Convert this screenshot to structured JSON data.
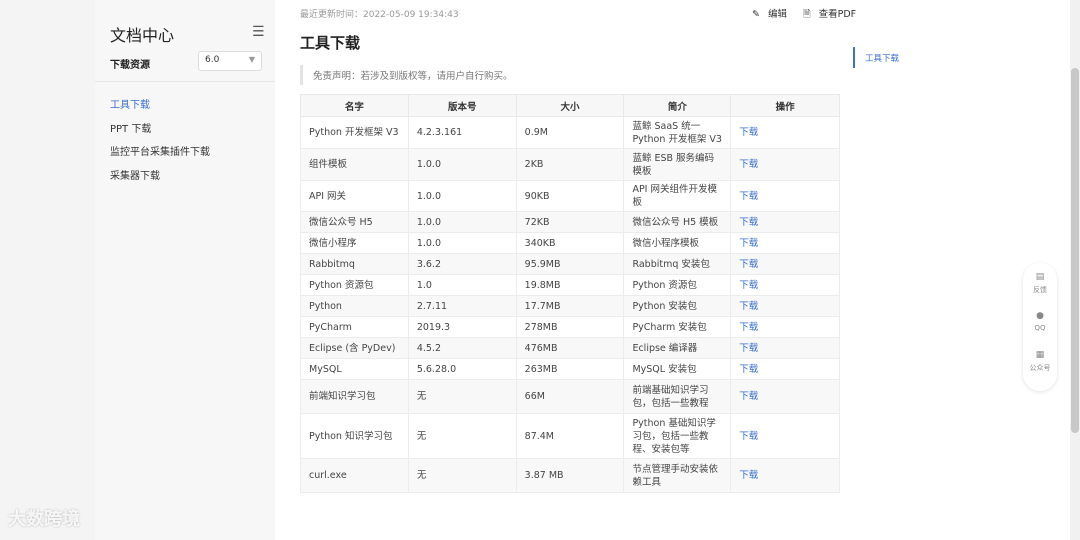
{
  "sidebar": {
    "title": "文档中心",
    "menu_icon": "hamburger-icon",
    "resource_label": "下载资源",
    "version_select": "6.0",
    "nav": [
      {
        "label": "工具下载",
        "active": true
      },
      {
        "label": "PPT 下载",
        "active": false
      },
      {
        "label": "监控平台采集插件下载",
        "active": false
      },
      {
        "label": "采集器下载",
        "active": false
      }
    ]
  },
  "header": {
    "updated": "最近更新时间：2022-05-09 19:34:43",
    "edit_label": "编辑",
    "pdf_label": "查看PDF",
    "edit_icon": "edit-icon",
    "pdf_icon": "document-icon"
  },
  "page": {
    "title": "工具下载",
    "disclaimer": "免责声明：若涉及到版权等，请用户自行购买。"
  },
  "table": {
    "headers": [
      "名字",
      "版本号",
      "大小",
      "简介",
      "操作"
    ],
    "rows": [
      {
        "name": "Python 开发框架 V3",
        "version": "4.2.3.161",
        "size": "0.9M",
        "desc": "蓝鲸 SaaS 统一 Python 开发框架 V3",
        "action": "下载"
      },
      {
        "name": "组件模板",
        "version": "1.0.0",
        "size": "2KB",
        "desc": "蓝鲸 ESB 服务编码模板",
        "action": "下载"
      },
      {
        "name": "API 网关",
        "version": "1.0.0",
        "size": "90KB",
        "desc": "API 网关组件开发模板",
        "action": "下载"
      },
      {
        "name": "微信公众号 H5",
        "version": "1.0.0",
        "size": "72KB",
        "desc": "微信公众号 H5 模板",
        "action": "下载"
      },
      {
        "name": "微信小程序",
        "version": "1.0.0",
        "size": "340KB",
        "desc": "微信小程序模板",
        "action": "下载"
      },
      {
        "name": "Rabbitmq",
        "version": "3.6.2",
        "size": "95.9MB",
        "desc": "Rabbitmq 安装包",
        "action": "下载"
      },
      {
        "name": "Python 资源包",
        "version": "1.0",
        "size": "19.8MB",
        "desc": "Python 资源包",
        "action": "下载"
      },
      {
        "name": "Python",
        "version": "2.7.11",
        "size": "17.7MB",
        "desc": "Python 安装包",
        "action": "下载"
      },
      {
        "name": "PyCharm",
        "version": "2019.3",
        "size": "278MB",
        "desc": "PyCharm 安装包",
        "action": "下载"
      },
      {
        "name": "Eclipse (含 PyDev)",
        "version": "4.5.2",
        "size": "476MB",
        "desc": "Eclipse 编译器",
        "action": "下载"
      },
      {
        "name": "MySQL",
        "version": "5.6.28.0",
        "size": "263MB",
        "desc": "MySQL 安装包",
        "action": "下载"
      },
      {
        "name": "前端知识学习包",
        "version": "无",
        "size": "66M",
        "desc": "前端基础知识学习包，包括一些教程",
        "action": "下载"
      },
      {
        "name": "Python 知识学习包",
        "version": "无",
        "size": "87.4M",
        "desc": "Python 基础知识学习包，包括一些教程、安装包等",
        "action": "下载"
      },
      {
        "name": "curl.exe",
        "version": "无",
        "size": "3.87 MB",
        "desc": "节点管理手动安装依赖工具",
        "action": "下载"
      }
    ]
  },
  "toc": {
    "active_item": "工具下载"
  },
  "float_panel": [
    {
      "label": "反馈",
      "icon": "feedback-icon"
    },
    {
      "label": "QQ",
      "icon": "qq-icon"
    },
    {
      "label": "公众号",
      "icon": "wechat-icon"
    }
  ],
  "watermark": "大数跨境",
  "colors": {
    "accent": "#3a6ed1",
    "sidebar_bg": "#f7f7f7",
    "header_bg": "#f7f7f7"
  }
}
